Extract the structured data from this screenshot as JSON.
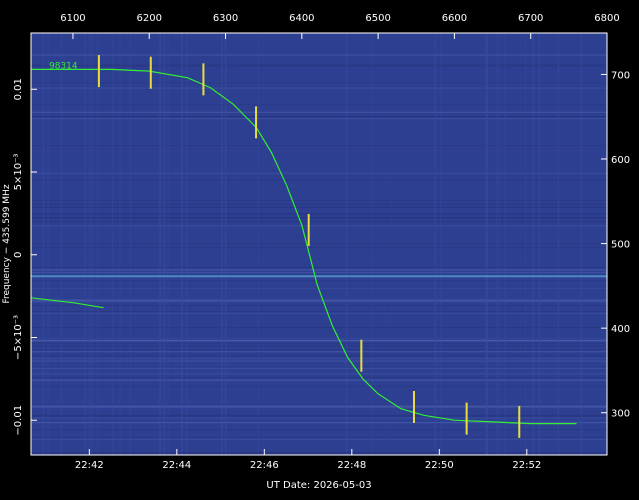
{
  "chart_data": {
    "type": "line",
    "title": "",
    "xlabel": "UT Date: 2026-05-03",
    "ylabel": "Frequency − 435.599 MHz",
    "x_axis_bottom": {
      "unit": "UT time",
      "range": [
        "22:40:40",
        "22:53:50"
      ],
      "ticks": [
        "22:42",
        "22:44",
        "22:46",
        "22:48",
        "22:50",
        "22:52"
      ]
    },
    "x_axis_top": {
      "range": [
        6045,
        6800
      ],
      "ticks": [
        "6100",
        "6200",
        "6300",
        "6400",
        "6500",
        "6600",
        "6700",
        "6800"
      ]
    },
    "y_axis_left": {
      "unit": "MHz offset",
      "range": [
        -0.0121,
        0.0134
      ],
      "ticks": [
        {
          "value": 0.01,
          "label": "0.01"
        },
        {
          "value": 0.005,
          "label": "5×10⁻³"
        },
        {
          "value": 0,
          "label": "0"
        },
        {
          "value": -0.005,
          "label": "−5×10⁻³"
        },
        {
          "value": -0.01,
          "label": "−0.01"
        }
      ]
    },
    "y_axis_right": {
      "range": [
        250,
        749
      ],
      "ticks": [
        "300",
        "400",
        "500",
        "600",
        "700"
      ]
    },
    "series": [
      {
        "name": "98314",
        "color": "#33ee33",
        "x": [
          6045,
          6100,
          6150,
          6200,
          6250,
          6280,
          6310,
          6340,
          6360,
          6380,
          6400,
          6410,
          6420,
          6440,
          6460,
          6480,
          6500,
          6530,
          6560,
          6600,
          6650,
          6700,
          6760
        ],
        "y": [
          0.0112,
          0.0112,
          0.0112,
          0.0111,
          0.0107,
          0.0101,
          0.0091,
          0.0077,
          0.0062,
          0.0042,
          0.0018,
          0.0,
          -0.0018,
          -0.0043,
          -0.0062,
          -0.0075,
          -0.0084,
          -0.0093,
          -0.0097,
          -0.01,
          -0.0101,
          -0.0102,
          -0.0102
        ]
      },
      {
        "name": "",
        "color": "#33ee33",
        "x": [
          6045,
          6100,
          6140
        ],
        "y": [
          -0.0026,
          -0.0029,
          -0.0032
        ]
      }
    ],
    "markers": {
      "color": "#ffee33",
      "points": [
        {
          "x": 6134,
          "y": 0.0111
        },
        {
          "x": 6202,
          "y": 0.011
        },
        {
          "x": 6271,
          "y": 0.0106
        },
        {
          "x": 6340,
          "y": 0.008
        },
        {
          "x": 6409,
          "y": 0.0015
        },
        {
          "x": 6478,
          "y": -0.0061
        },
        {
          "x": 6547,
          "y": -0.0092
        },
        {
          "x": 6616,
          "y": -0.0099
        },
        {
          "x": 6685,
          "y": -0.0101
        }
      ]
    },
    "background": "#2d3f91",
    "legend_position": "top-left",
    "grid": false
  }
}
